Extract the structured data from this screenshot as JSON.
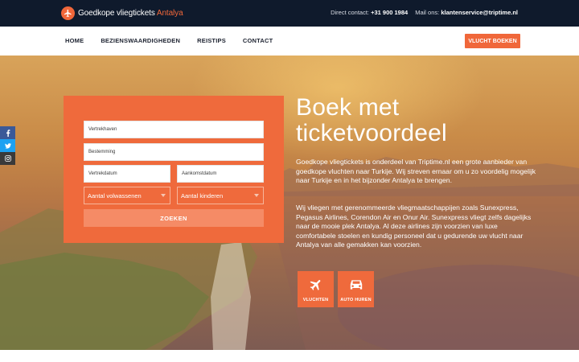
{
  "brand": {
    "name": "Goedkope vliegtickets",
    "accent": "Antalya",
    "accent_color": "#f0673a",
    "topbar_color": "#0f1a2c"
  },
  "contact": {
    "direct_label": "Direct contact:",
    "phone": "+31 900 1984",
    "mail_label": "Mail ons:",
    "email": "klantenservice@triptime.nl"
  },
  "nav": {
    "items": [
      {
        "label": "HOME"
      },
      {
        "label": "BEZIENSWAARDIGHEDEN"
      },
      {
        "label": "REISTIPS"
      },
      {
        "label": "CONTACT"
      }
    ],
    "cta_label": "VLUCHT BOEKEN"
  },
  "social": [
    {
      "icon": "facebook-icon"
    },
    {
      "icon": "twitter-icon"
    },
    {
      "icon": "instagram-icon"
    }
  ],
  "search": {
    "departure_placeholder": "Vertrekhaven",
    "destination_placeholder": "Bestemming",
    "depart_date_placeholder": "Vertrekdatum",
    "return_date_placeholder": "Aankomstdatum",
    "adults_value": "Aantal volwassenen",
    "children_value": "Aantal kinderen",
    "submit_label": "ZOEKEN"
  },
  "hero": {
    "title_line1": "Boek met",
    "title_line2": "ticketvoordeel",
    "paragraph1": "Goedkope vliegtickets is onderdeel van Triptime.nl een grote aanbieder van goedkope vluchten naar Turkije. Wij streven ernaar om u zo voordelig mogelijk naar Turkije en in het bijzonder Antalya te brengen.",
    "paragraph2": "Wij vliegen met gerenommeerde vliegmaatschappijen zoals Sunexpress, Pegasus Airlines, Corendon Air en Onur Air. Sunexpress vliegt zelfs dagelijks naar de mooie plek Antalya. Al deze airlines zijn voorzien van luxe comfortabele stoelen en kundig personeel dat u gedurende uw vlucht naar Antalya van alle gemakken kan voorzien."
  },
  "tiles": [
    {
      "label": "VLUCHTEN",
      "icon": "airplane-icon"
    },
    {
      "label": "AUTO HUREN",
      "icon": "car-icon"
    }
  ]
}
